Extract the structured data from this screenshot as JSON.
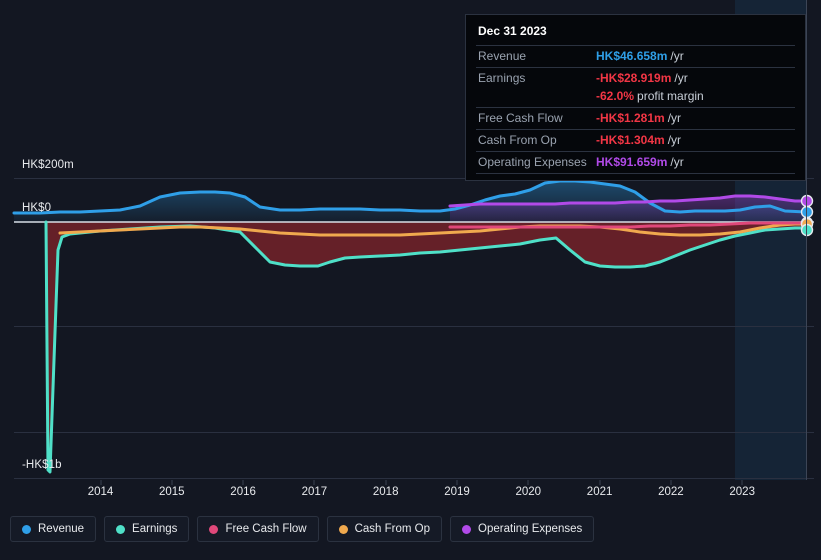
{
  "chart_data": {
    "type": "area",
    "title": "",
    "xlabel": "",
    "ylabel": "",
    "currency": "HK$",
    "grid": true,
    "legend_position": "bottom",
    "x": [
      2013.2,
      2013.4,
      2013.6,
      2014,
      2014.5,
      2015,
      2015.5,
      2016,
      2016.5,
      2017,
      2017.5,
      2018,
      2018.5,
      2019,
      2019.5,
      2020,
      2020.5,
      2021,
      2021.5,
      2022,
      2022.5,
      2023,
      2023.5,
      2023.95
    ],
    "xlim": [
      2013.15,
      2024.05
    ],
    "ylim": [
      -1000,
      260
    ],
    "ytick_values": [
      200,
      0,
      -1000
    ],
    "ytick_labels": [
      "HK$200m",
      "HK$0",
      "-HK$1b"
    ],
    "xtick_labels": [
      "2014",
      "2015",
      "2016",
      "2017",
      "2018",
      "2019",
      "2020",
      "2021",
      "2022",
      "2023"
    ],
    "series": [
      {
        "name": "Revenue",
        "color": "#2f9fe8",
        "values": [
          40,
          38,
          38,
          38,
          45,
          75,
          80,
          80,
          98,
          100,
          95,
          78,
          40,
          38,
          42,
          95,
          155,
          150,
          128,
          45,
          40,
          42,
          78,
          82
        ]
      },
      {
        "name": "Earnings",
        "color": "#4fe0c8",
        "values": [
          -995,
          -520,
          -70,
          -60,
          -48,
          -40,
          -20,
          -15,
          -25,
          -175,
          -178,
          -150,
          -148,
          -145,
          -142,
          -60,
          -62,
          -200,
          -205,
          -135,
          -120,
          -100,
          -55,
          -52
        ]
      },
      {
        "name": "Free Cash Flow",
        "color": "#e0487a",
        "values": [
          null,
          null,
          null,
          null,
          null,
          null,
          null,
          null,
          null,
          null,
          null,
          null,
          null,
          -18,
          -16,
          -14,
          -12,
          -12,
          -12,
          -10,
          -8,
          -6,
          -5,
          -5
        ]
      },
      {
        "name": "Cash From Op",
        "color": "#f0a94e",
        "values": [
          -40,
          -40,
          -38,
          -36,
          -30,
          -20,
          -12,
          -10,
          -12,
          -18,
          -22,
          -24,
          -24,
          -22,
          -14,
          -8,
          -6,
          -8,
          -20,
          -30,
          -26,
          -18,
          -10,
          -8
        ]
      },
      {
        "name": "Operating Expenses",
        "color": "#b14ae8",
        "values": [
          null,
          null,
          null,
          null,
          null,
          null,
          null,
          null,
          null,
          null,
          null,
          null,
          null,
          42,
          45,
          45,
          46,
          46,
          48,
          55,
          60,
          58,
          88,
          92
        ]
      }
    ],
    "endpoint_markers": [
      {
        "name": "Operating Expenses",
        "color": "#b14ae8"
      },
      {
        "name": "Revenue",
        "color": "#2f9fe8"
      },
      {
        "name": "Free Cash Flow",
        "color": "#e0487a"
      },
      {
        "name": "Cash From Op",
        "color": "#f0a94e"
      },
      {
        "name": "Earnings",
        "color": "#4fe0c8"
      }
    ]
  },
  "axis": {
    "y_top_label": "HK$200m",
    "y_zero_label": "HK$0",
    "y_bottom_label": "-HK$1b",
    "x_labels": [
      "2014",
      "2015",
      "2016",
      "2017",
      "2018",
      "2019",
      "2020",
      "2021",
      "2022",
      "2023"
    ]
  },
  "tooltip": {
    "date": "Dec 31 2023",
    "rows": [
      {
        "key": "Revenue",
        "value": "HK$46.658m",
        "unit": "/yr",
        "color": "blue"
      },
      {
        "key": "Earnings",
        "value": "-HK$28.919m",
        "unit": "/yr",
        "color": "red"
      },
      {
        "key": "",
        "value": "-62.0%",
        "unit": "profit margin",
        "color": "red"
      },
      {
        "key": "Free Cash Flow",
        "value": "-HK$1.281m",
        "unit": "/yr",
        "color": "red"
      },
      {
        "key": "Cash From Op",
        "value": "-HK$1.304m",
        "unit": "/yr",
        "color": "red"
      },
      {
        "key": "Operating Expenses",
        "value": "HK$91.659m",
        "unit": "/yr",
        "color": "purple"
      }
    ]
  },
  "legend": {
    "items": [
      {
        "label": "Revenue",
        "color": "#2f9fe8"
      },
      {
        "label": "Earnings",
        "color": "#4fe0c8"
      },
      {
        "label": "Free Cash Flow",
        "color": "#e0487a"
      },
      {
        "label": "Cash From Op",
        "color": "#f0a94e"
      },
      {
        "label": "Operating Expenses",
        "color": "#b14ae8"
      }
    ]
  },
  "colors": {
    "background": "#131722",
    "grid": "#2a3040",
    "zero_line": "#d8dde6",
    "negative_fill": "#6d2229",
    "highlight_band": "#16273a"
  }
}
